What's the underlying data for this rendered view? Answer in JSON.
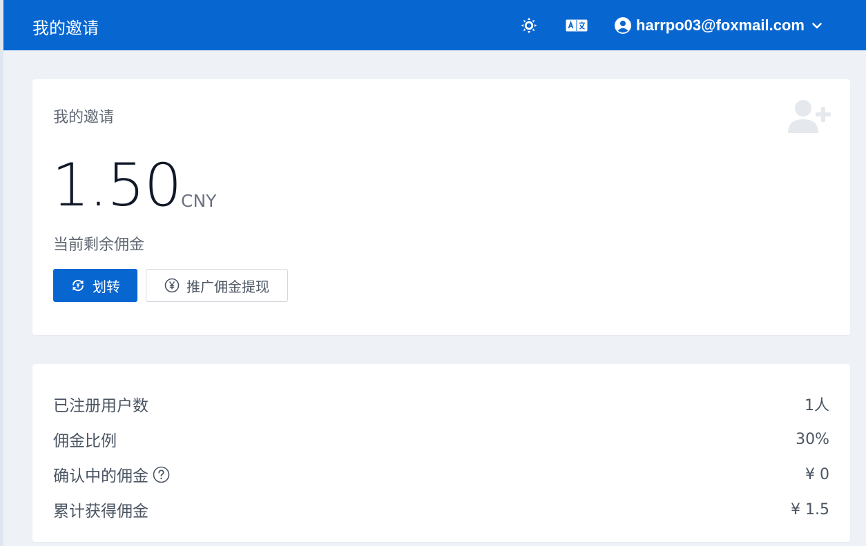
{
  "header": {
    "title": "我的邀请",
    "theme_icon": "sun-icon",
    "language_icon": "translate-icon",
    "user_icon": "user-circle-icon",
    "user_email": "harrpo03@foxmail.com",
    "dropdown_icon": "chevron-down-icon",
    "accent_color": "#0866d1"
  },
  "invite_card": {
    "title": "我的邀请",
    "icon": "user-plus-icon",
    "amount": "1.50",
    "currency": "CNY",
    "amount_label": "当前剩余佣金",
    "transfer_button": "划转",
    "transfer_icon": "transfer-cycle-icon",
    "withdraw_button": "推广佣金提现",
    "withdraw_icon": "yen-circle-icon"
  },
  "stats": [
    {
      "label": "已注册用户数",
      "value": "1人"
    },
    {
      "label": "佣金比例",
      "value": "30%"
    },
    {
      "label": "确认中的佣金",
      "value": "¥ 0",
      "help_icon": "question-circle-icon"
    },
    {
      "label": "累计获得佣金",
      "value": "¥ 1.5"
    }
  ]
}
